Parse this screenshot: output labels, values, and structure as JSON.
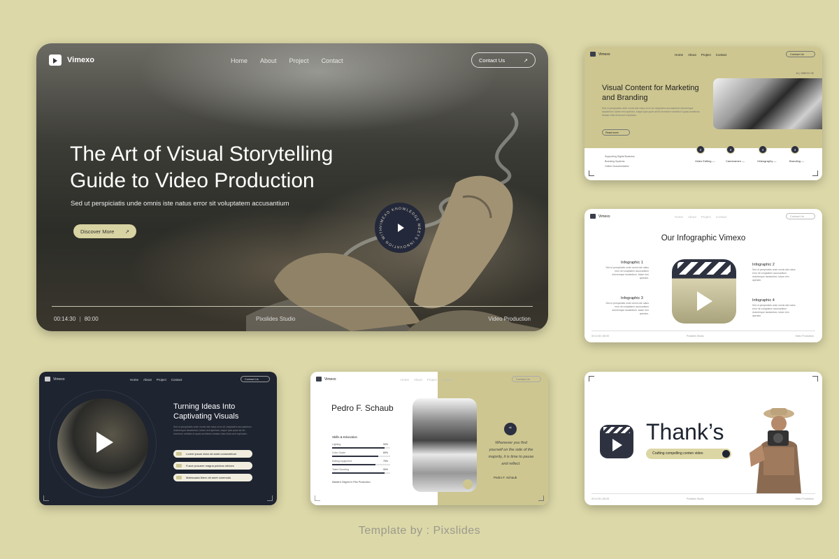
{
  "hero": {
    "logo": "Vimexo",
    "nav": [
      "Home",
      "About",
      "Project",
      "Contact"
    ],
    "contact_label": "Contact Us",
    "title_line1": "The Art of Visual Storytelling",
    "title_line2": "Guide to Video Production",
    "subtitle": "Sed ut perspiciatis unde omnis iste natus error sit voluptatem accusantium",
    "cta_label": "Discover More",
    "badge_text": "VIMEXO KNOWLEDGE MEETS INNOVATION WITH",
    "timecode": "00:14:30",
    "duration": "80:00",
    "studio": "Pixslides Studio",
    "category": "Video Production"
  },
  "slide2": {
    "logo": "Vimexo",
    "nav": [
      "Home",
      "About",
      "Project",
      "Contact"
    ],
    "contact_label": "Contact Us",
    "title": "Visual Content for Marketing and Branding",
    "body": "Sed ut perspiciatis unde omnis iste natus error sit voluptatem accusantium doloremque laudantium, totam rem aperiam, eaque ipsa quae ab illo inventore veritatis et quasi architecto beatae vitae dicta sunt explicabo.",
    "button": "Read more",
    "tag": "44 | VIMEXO 2K",
    "bullets": [
      "Supporting Digital Business",
      "Branding Systems",
      "Online Documentation"
    ],
    "steps": [
      {
        "num": "2",
        "label": "Video Editing —"
      },
      {
        "num": "3",
        "label": "Cameramen —"
      },
      {
        "num": "4",
        "label": "Videography —"
      },
      {
        "num": "4",
        "label": "Branding —"
      }
    ]
  },
  "slide3": {
    "logo": "Vimexo",
    "nav": [
      "Home",
      "About",
      "Project",
      "Contact"
    ],
    "contact_label": "Contact Us",
    "heading": "Our Infographic Vimexo",
    "items": [
      "Infographic 1",
      "Infographic 2",
      "Infographic 3",
      "Infographic 4"
    ],
    "item_body": "Sed ut perspiciatis unde omnis iste natus error sit voluptatem accusantium doloremque laudantium, totam rem aperiam.",
    "footer": [
      "00:14:30 | 80:00",
      "Pixslides Studio",
      "Video Production"
    ]
  },
  "slide4": {
    "logo": "Vimexo",
    "nav": [
      "Home",
      "About",
      "Project",
      "Contact"
    ],
    "contact_label": "Contact Us",
    "title": "Turning Ideas Into Captivating Visuals",
    "body": "Sed ut perspiciatis unde omnis iste natus error sit voluptatem accusantium doloremque laudantium, totam rem aperiam, eaque ipsa quae ab illo inventore veritatis et quasi architecto beatae vitae dicta sunt explicabo.",
    "pills": [
      "Lorem ipsum dolor sit amet consectetuer",
      "Fusce posuere magna pulvinar ultrices",
      "Malesuada libero sit amet commodo"
    ]
  },
  "slide5": {
    "logo": "Vimexo",
    "nav": [
      "Home",
      "About",
      "Project",
      "Contact"
    ],
    "contact_label": "Contact Us",
    "name": "Pedro F. Schaub",
    "skills_heading": "Skills & Education",
    "skills": [
      {
        "label": "Lighting",
        "pct": "90%",
        "fill": 0.9
      },
      {
        "label": "Color Grade",
        "pct": "80%",
        "fill": 0.8
      },
      {
        "label": "Editing equipment",
        "pct": "75%",
        "fill": 0.75
      },
      {
        "label": "Talent Scouting",
        "pct": "90%",
        "fill": 0.9
      }
    ],
    "degree": "Master's Degree in Film Production",
    "quote_mark": "“",
    "quote": "Whenever you find yourself on the side of the majority, it is time to pause and reflect.",
    "author": "Pedro F. Schaub"
  },
  "slide6": {
    "thanks": "Thank’s",
    "pill": "Crafting compelling conten video",
    "footer": [
      "00:14:30 | 80:00",
      "Pixslides Studio",
      "Video Production"
    ]
  },
  "credit": "Template by : Pixslides",
  "colors": {
    "background": "#dcd8a8",
    "accent": "#cdc690",
    "navy": "#1e2430"
  }
}
